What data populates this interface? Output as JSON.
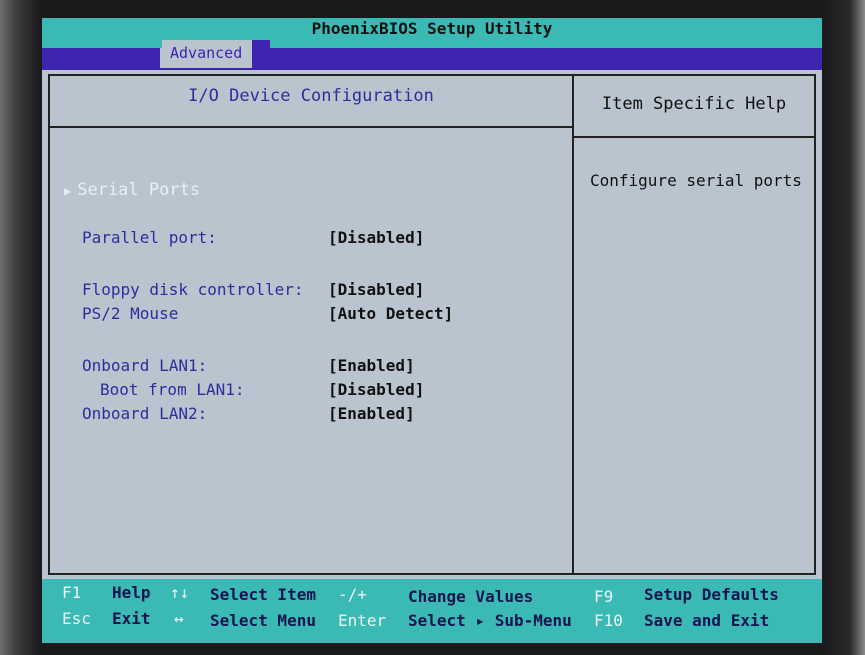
{
  "title": "PhoenixBIOS Setup Utility",
  "active_tab": "Advanced",
  "main": {
    "header": "I/O Device Configuration",
    "submenu": "Serial Ports",
    "items": [
      {
        "label": "Parallel port:",
        "value": "[Disabled]"
      },
      {
        "label": "Floppy disk controller:",
        "value": "[Disabled]"
      },
      {
        "label": "PS/2 Mouse",
        "value": "[Auto Detect]"
      },
      {
        "label": "Onboard LAN1:",
        "value": "[Enabled]"
      },
      {
        "label": "Boot from LAN1:",
        "value": "[Disabled]"
      },
      {
        "label": "Onboard LAN2:",
        "value": "[Enabled]"
      }
    ]
  },
  "help": {
    "header": "Item Specific Help",
    "text": "Configure serial ports"
  },
  "footer": {
    "f1_key": "F1",
    "f1_label": "Help",
    "updown_key": "↑↓",
    "updown_label": "Select Item",
    "minusplus_key": "-/+",
    "minusplus_label": "Change Values",
    "f9_key": "F9",
    "f9_label": "Setup Defaults",
    "esc_key": "Esc",
    "esc_label": "Exit",
    "leftright_key": "↔",
    "leftright_label": "Select Menu",
    "enter_key": "Enter",
    "enter_label": "Select ▸ Sub-Menu",
    "f10_key": "F10",
    "f10_label": "Save and Exit"
  },
  "colors": {
    "title_bg": "#3bb9b4",
    "menu_bg": "#3f24b0",
    "screen_bg": "#b9c4cf",
    "item_text": "#2a2f9c"
  }
}
